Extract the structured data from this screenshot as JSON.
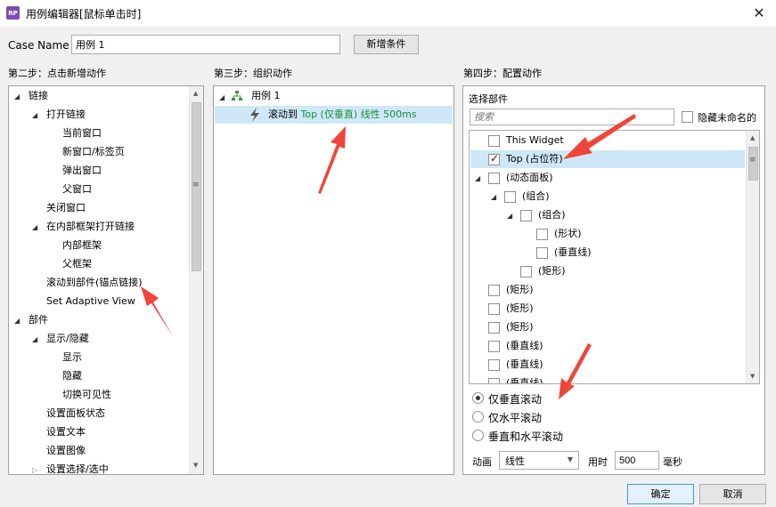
{
  "window": {
    "app_icon": "RP",
    "title": "用例编辑器[鼠标单击时]",
    "close": "✕"
  },
  "case": {
    "label": "Case Name",
    "value": "用例 1",
    "add_condition": "新增条件"
  },
  "steps": {
    "step2": "第二步：点击新增动作",
    "step3": "第三步：组织动作",
    "step4": "第四步：配置动作"
  },
  "actions_tree": [
    {
      "label": "链接",
      "expanded": true
    },
    {
      "label": "打开链接",
      "expanded": true
    },
    {
      "label": "当前窗口"
    },
    {
      "label": "新窗口/标签页"
    },
    {
      "label": "弹出窗口"
    },
    {
      "label": "父窗口"
    },
    {
      "label": "关闭窗口"
    },
    {
      "label": "在内部框架打开链接",
      "expanded": true
    },
    {
      "label": "内部框架"
    },
    {
      "label": "父框架"
    },
    {
      "label": "滚动到部件(锚点链接)"
    },
    {
      "label": "Set Adaptive View"
    },
    {
      "label": "部件",
      "expanded": true
    },
    {
      "label": "显示/隐藏",
      "expanded": true
    },
    {
      "label": "显示"
    },
    {
      "label": "隐藏"
    },
    {
      "label": "切换可见性"
    },
    {
      "label": "设置面板状态"
    },
    {
      "label": "设置文本"
    },
    {
      "label": "设置图像"
    },
    {
      "label": "设置选择/选中",
      "expanded": false
    }
  ],
  "organize": {
    "case_label": "用例 1",
    "action_prefix": "滚动到 ",
    "action_detail": "Top (仅垂直) 线性 500ms"
  },
  "configure": {
    "select_widget_label": "选择部件",
    "search_placeholder": "搜索",
    "hide_unnamed": "隐藏未命名的",
    "widgets": [
      {
        "label": "This Widget",
        "checked": false
      },
      {
        "label": "Top (占位符)",
        "checked": true,
        "selected": true
      },
      {
        "label": "(动态面板)",
        "checked": false,
        "expanded": true
      },
      {
        "label": "(组合)",
        "checked": false,
        "expanded": true
      },
      {
        "label": "(组合)",
        "checked": false,
        "expanded": true
      },
      {
        "label": "(形状)",
        "checked": false
      },
      {
        "label": "(垂直线)",
        "checked": false
      },
      {
        "label": "(矩形)",
        "checked": false
      },
      {
        "label": "(矩形)",
        "checked": false
      },
      {
        "label": "(矩形)",
        "checked": false
      },
      {
        "label": "(矩形)",
        "checked": false
      },
      {
        "label": "(垂直线)",
        "checked": false
      },
      {
        "label": "(垂直线)",
        "checked": false
      },
      {
        "label": "(垂直线)",
        "checked": false
      }
    ],
    "scroll_options": [
      {
        "label": "仅垂直滚动",
        "selected": true
      },
      {
        "label": "仅水平滚动",
        "selected": false
      },
      {
        "label": "垂直和水平滚动",
        "selected": false
      }
    ],
    "animation_label": "动画",
    "animation_value": "线性",
    "duration_label": "用时",
    "duration_value": "500",
    "duration_unit": "毫秒"
  },
  "footer": {
    "ok": "确定",
    "cancel": "取消"
  },
  "icons": {
    "collapse": "◢",
    "expand": "▷",
    "dropdown": "▼",
    "action": "lightning-icon",
    "case": "case-tree-icon"
  },
  "colors": {
    "accent": "#3399ff",
    "selection": "#cfe8f7",
    "annotation_arrow": "#f0453a",
    "action_text": "#1a8f3c"
  }
}
